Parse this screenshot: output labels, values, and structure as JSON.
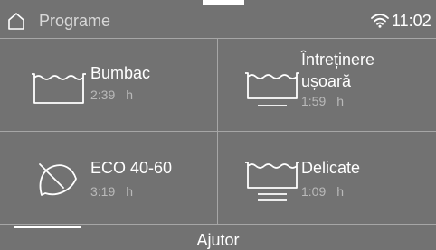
{
  "header": {
    "title": "Programe",
    "time": "11:02",
    "home_icon": "home-icon",
    "wifi_icon": "wifi-icon"
  },
  "programs": [
    {
      "label_line1": "Bumbac",
      "label_line2": "",
      "time": "2:39",
      "unit": "h",
      "icon": "tub-icon"
    },
    {
      "label_line1": "Întreținere",
      "label_line2": "ușoară",
      "time": "1:59",
      "unit": "h",
      "icon": "tub-one-bar-icon"
    },
    {
      "label_line1": "ECO 40-60",
      "label_line2": "",
      "time": "3:19",
      "unit": "h",
      "icon": "leaf-icon"
    },
    {
      "label_line1": "Delicate",
      "label_line2": "",
      "time": "1:09",
      "unit": "h",
      "icon": "tub-two-bars-icon"
    }
  ],
  "footer": {
    "help_label": "Ajutor"
  },
  "colors": {
    "background": "#727272",
    "divider": "#a6a6a6",
    "text": "#ffffff",
    "muted_text": "#b9b9b9"
  }
}
